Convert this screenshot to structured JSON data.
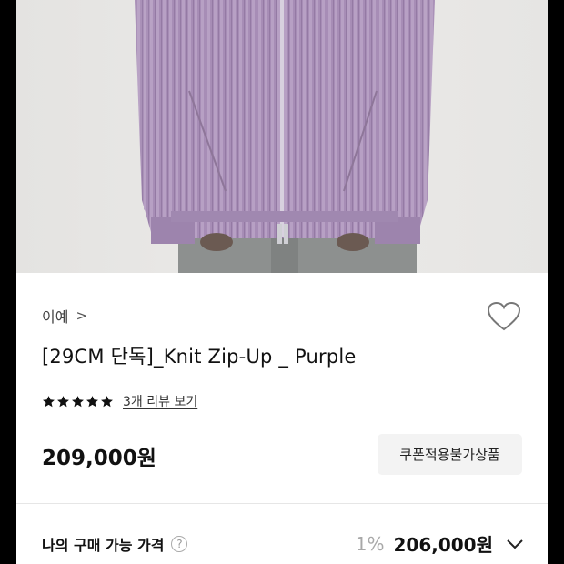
{
  "product": {
    "brand": "이예",
    "brand_arrow": ">",
    "title": "[29CM 단독]_Knit Zip-Up _ Purple",
    "rating_stars": 5,
    "review_link": "3개 리뷰 보기",
    "price": "209,000원",
    "coupon_button": "쿠폰적용불가상품"
  },
  "purchase": {
    "label": "나의 구매 가능 가격",
    "help_icon": "?",
    "discount": "1%",
    "final_price": "206,000원"
  },
  "colors": {
    "sweater": "#a88fb8",
    "pants": "#8f9290",
    "background": "#e8e7e5"
  }
}
